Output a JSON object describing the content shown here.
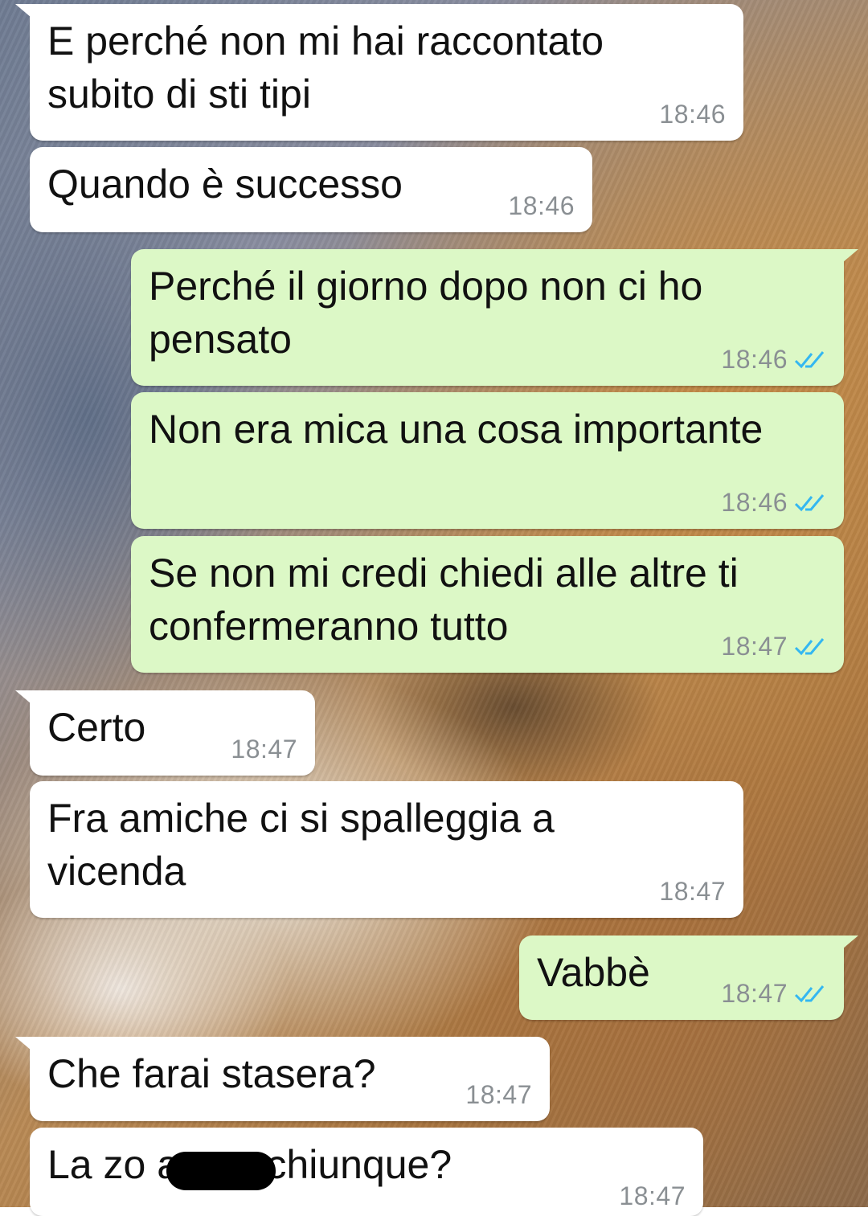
{
  "colors": {
    "incoming_bubble": "#ffffff",
    "outgoing_bubble": "#dcf8c6",
    "timestamp": "#8a8f93",
    "read_receipt": "#34b7f1"
  },
  "messages": [
    {
      "direction": "incoming",
      "text": "E perché non mi hai raccontato\nsubito di sti tipi",
      "time": "18:46"
    },
    {
      "direction": "incoming",
      "text": "Quando è successo",
      "time": "18:46"
    },
    {
      "direction": "outgoing",
      "text": "Perché il giorno dopo non ci ho\npensato",
      "time": "18:46",
      "status": "read-double-check-icon"
    },
    {
      "direction": "outgoing",
      "text": "Non era mica una cosa importante",
      "time": "18:46",
      "status": "read-double-check-icon"
    },
    {
      "direction": "outgoing",
      "text": "Se non mi credi chiedi alle altre ti\nconfermeranno tutto",
      "time": "18:47",
      "status": "read-double-check-icon"
    },
    {
      "direction": "incoming",
      "text": "Certo",
      "time": "18:47"
    },
    {
      "direction": "incoming",
      "text": "Fra amiche ci si spalleggia a\nvicenda",
      "time": "18:47"
    },
    {
      "direction": "outgoing",
      "text": "Vabbè",
      "time": "18:47",
      "status": "read-double-check-icon"
    },
    {
      "direction": "incoming",
      "text": "Che farai stasera?",
      "time": "18:47"
    },
    {
      "direction": "incoming",
      "text": "La zo        a con chiunque?",
      "time": "18:47",
      "note": "partially redacted"
    }
  ]
}
